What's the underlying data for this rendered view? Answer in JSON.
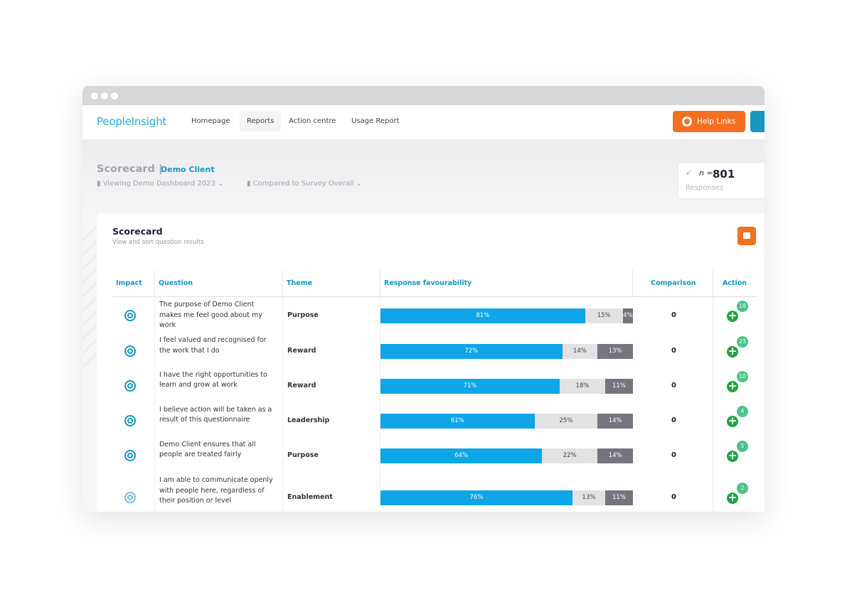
{
  "nav": {
    "logo": "PeopleInsight",
    "items": [
      "Homepage",
      "Reports",
      "Action centre",
      "Usage Report"
    ],
    "active": "Reports",
    "help": "Help Links"
  },
  "header": {
    "title": "Scorecard |",
    "client": "Demo Client",
    "viewing": "Viewing Demo Dashboard 2023",
    "compared": "Compared to Survey Overall",
    "n_label": "n =",
    "n_value": "801",
    "responses_label": "Responses"
  },
  "card": {
    "title": "Scorecard",
    "subtitle": "View and sort question results"
  },
  "columns": [
    "Impact",
    "Question",
    "Theme",
    "Response favourability",
    "Comparison",
    "Action"
  ],
  "colors": {
    "favourable": "#0ea5e9",
    "neutral": "#e2e2e4",
    "unfavourable": "#74757d",
    "accent": "#f36f21",
    "brand": "#1597c0",
    "action": "#22a447"
  },
  "rows": [
    {
      "question": "The purpose of Demo Client makes me feel good about my work",
      "theme": "Purpose",
      "fav": 81,
      "neu": 15,
      "unf": 4,
      "fav_label": "81%",
      "neu_label": "15%",
      "unf_label": "4%",
      "comparison": "0",
      "actions": "18",
      "impact": "high"
    },
    {
      "question": "I feel valued and recognised for the work that I do",
      "theme": "Reward",
      "fav": 72,
      "neu": 14,
      "unf": 13,
      "fav_label": "72%",
      "neu_label": "14%",
      "unf_label": "13%",
      "comparison": "0",
      "actions": "23",
      "impact": "high"
    },
    {
      "question": "I have the right opportunities to learn and grow at work",
      "theme": "Reward",
      "fav": 71,
      "neu": 18,
      "unf": 11,
      "fav_label": "71%",
      "neu_label": "18%",
      "unf_label": "11%",
      "comparison": "0",
      "actions": "10",
      "impact": "high"
    },
    {
      "question": "I believe action will be taken as a result of this questionnaire",
      "theme": "Leadership",
      "fav": 61,
      "neu": 25,
      "unf": 14,
      "fav_label": "61%",
      "neu_label": "25%",
      "unf_label": "14%",
      "comparison": "0",
      "actions": "4",
      "impact": "high"
    },
    {
      "question": "Demo Client ensures that all people are treated fairly",
      "theme": "Purpose",
      "fav": 64,
      "neu": 22,
      "unf": 14,
      "fav_label": "64%",
      "neu_label": "22%",
      "unf_label": "14%",
      "comparison": "0",
      "actions": "5",
      "impact": "high"
    },
    {
      "question": "I am able to communicate openly with people here, regardless of their position or level",
      "theme": "Enablement",
      "fav": 76,
      "neu": 13,
      "unf": 11,
      "fav_label": "76%",
      "neu_label": "13%",
      "unf_label": "11%",
      "comparison": "0",
      "actions": "2",
      "impact": "medium"
    }
  ]
}
